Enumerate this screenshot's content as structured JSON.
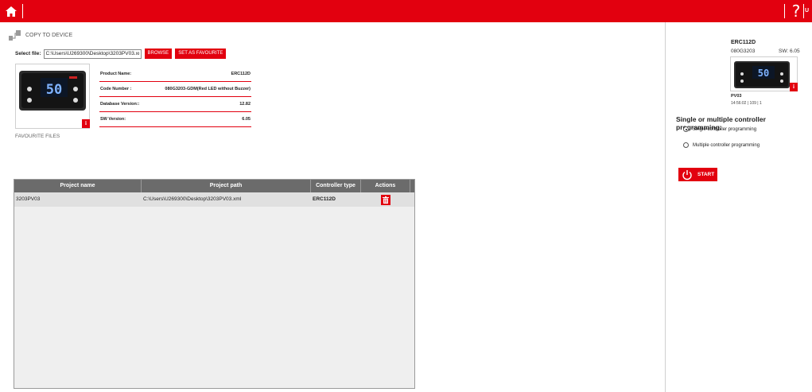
{
  "topbar": {
    "home_icon": "home-icon",
    "help_label": "?",
    "user_label": "U"
  },
  "copy_to_device": {
    "icon": "copy-to-device-icon",
    "label": "COPY TO DEVICE"
  },
  "select_file": {
    "label": "Select file:",
    "value": "C:\\Users\\U269300\\Desktop\\3203PV03.xml",
    "browse_label": "BROWSE",
    "favourite_label": "SET AS FAVOURITE"
  },
  "device_display_value": "50",
  "info_badge": "i",
  "product_info": [
    {
      "label": "Product Name:",
      "value": "ERC112D"
    },
    {
      "label": "Code Number :",
      "value": "080G3203-GDM(Red LED without Buzzer)"
    },
    {
      "label": "Database Version::",
      "value": "12.82"
    },
    {
      "label": "SW Version:",
      "value": "6.05"
    }
  ],
  "favourite_files_label": "FAVOURITE FILES",
  "projects_table": {
    "columns": [
      "Project name",
      "Project path",
      "Controller type",
      "Actions"
    ],
    "rows": [
      {
        "name": "3203PV03",
        "path": "C:\\Users\\U269300\\Desktop\\3203PV03.xml",
        "controller": "ERC112D",
        "action_icon": "trash-icon"
      }
    ]
  },
  "right_panel": {
    "title": "ERC112D",
    "code": "080G3203",
    "sw": "SW: 6.05",
    "project": "PV03",
    "meta": "14:56:02 | 109 | 1",
    "programming_title": "Single or multiple controller programming:",
    "option_single": "Single controller programming",
    "option_multiple": "Multiple controller programming",
    "selected_option": "single",
    "start_label": "START"
  },
  "colors": {
    "brand_red": "#e2000f",
    "table_header": "#6b6b6b",
    "table_bg": "#efefef",
    "row_bg": "#e0e0e0"
  }
}
